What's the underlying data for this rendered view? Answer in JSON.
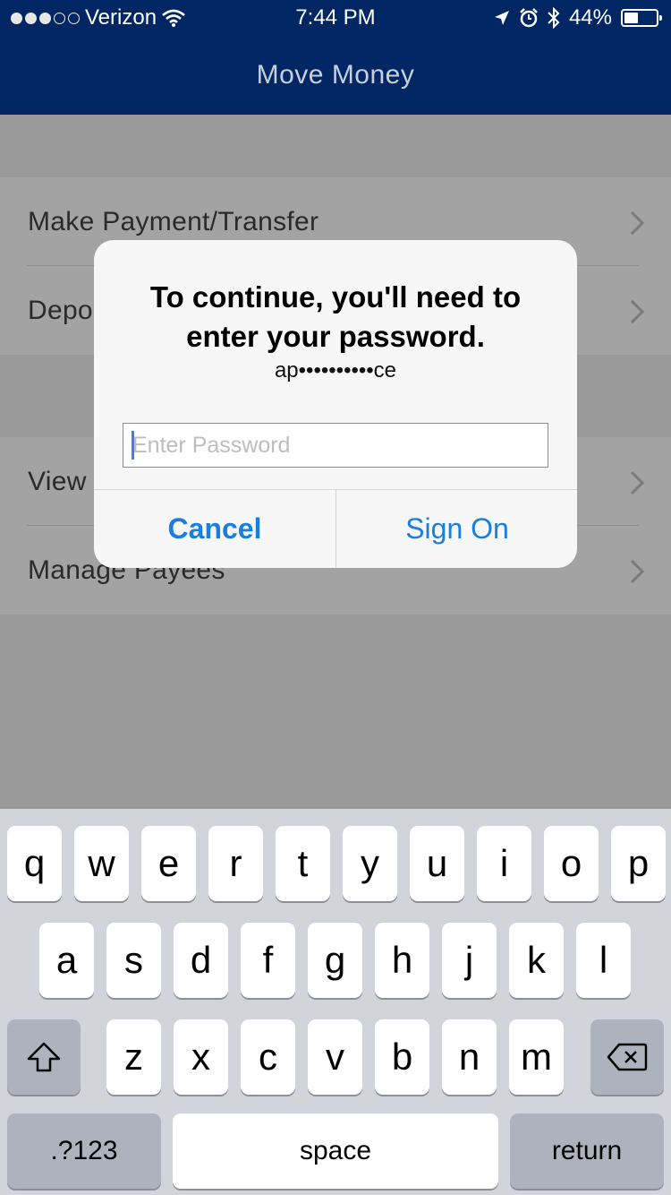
{
  "status_bar": {
    "carrier": "Verizon",
    "time": "7:44 PM",
    "battery": "44%",
    "battery_level": 0.44,
    "signal_bars": 3
  },
  "nav": {
    "title": "Move Money"
  },
  "menu": {
    "items": [
      {
        "label": "Make Payment/Transfer"
      },
      {
        "label": "Depo"
      },
      {
        "label": "View"
      },
      {
        "label": "Manage Payees"
      }
    ]
  },
  "dialog": {
    "title_line1": "To continue, you'll need to",
    "title_line2": "enter your password.",
    "account": "ap••••••••••ce",
    "password_placeholder": "Enter Password",
    "password_value": "",
    "cancel_label": "Cancel",
    "signon_label": "Sign On"
  },
  "keyboard": {
    "row1": [
      "q",
      "w",
      "e",
      "r",
      "t",
      "y",
      "u",
      "i",
      "o",
      "p"
    ],
    "row2": [
      "a",
      "s",
      "d",
      "f",
      "g",
      "h",
      "j",
      "k",
      "l"
    ],
    "row3": [
      "z",
      "x",
      "c",
      "v",
      "b",
      "n",
      "m"
    ],
    "numbers_label": ".?123",
    "space_label": "space",
    "return_label": "return"
  },
  "icons": {
    "wifi": "wifi-icon",
    "location": "location-arrow-icon",
    "alarm": "alarm-clock-icon",
    "bluetooth": "bluetooth-icon",
    "chevron": "chevron-right-icon",
    "shift": "shift-icon",
    "delete": "delete-backspace-icon"
  },
  "colors": {
    "nav_bg": "#002663",
    "dialog_button": "#1a7de0",
    "caret": "#4a78f0"
  }
}
